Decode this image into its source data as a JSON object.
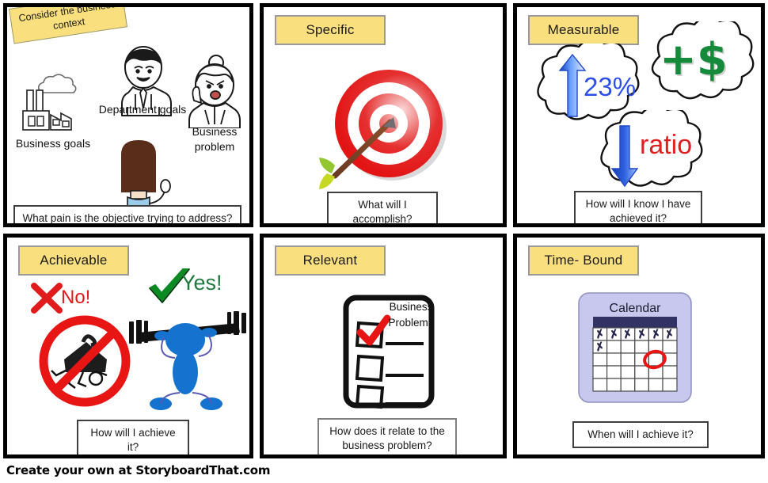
{
  "footer": {
    "text": "Create your own at StoryboardThat.com"
  },
  "panels": [
    {
      "id": "business-context",
      "sticky_note": "Consider the business context",
      "title": null,
      "caption": "What pain is the objective trying to address?",
      "labels": {
        "factory": "Business goals",
        "manager": "Department goals",
        "customer": "Business problem"
      },
      "icons": [
        "factory-icon",
        "smoke-cloud-icon",
        "businessman-figure",
        "angry-woman-figure",
        "woman-raising-hand-figure"
      ]
    },
    {
      "id": "specific",
      "title": "Specific",
      "caption": "What will I accomplish?",
      "icons": [
        "target-dartboard-icon",
        "arrow-icon"
      ]
    },
    {
      "id": "measurable",
      "title": "Measurable",
      "caption": "How will I know I have achieved it?",
      "clouds": [
        {
          "name": "percent-cloud",
          "icon": "up-arrow-icon",
          "text": "23%",
          "color": "#2b4fe8"
        },
        {
          "name": "money-cloud",
          "icon": "dollar-icon",
          "text": "+$",
          "color": "#158A3B"
        },
        {
          "name": "ratio-cloud",
          "icon": "down-arrow-icon",
          "text": "ratio",
          "color": "#E02020"
        }
      ]
    },
    {
      "id": "achievable",
      "title": "Achievable",
      "caption": "How will I achieve it?",
      "marks": [
        {
          "name": "no-mark",
          "symbol": "x-mark-icon",
          "label": "No!",
          "color": "#E01B1B"
        },
        {
          "name": "yes-mark",
          "symbol": "check-mark-icon",
          "label": "Yes!",
          "color": "#1E7A3C"
        }
      ],
      "icons": [
        "prohibition-sign-icon",
        "crushed-stick-figure-icon",
        "weightlifter-figure-icon",
        "barbell-icon"
      ]
    },
    {
      "id": "relevant",
      "title": "Relevant",
      "caption": "How does it relate to the business problem?",
      "checklist": {
        "heading_line1": "Business",
        "heading_line2": "Problems",
        "items": [
          {
            "checked": true
          },
          {
            "checked": false
          },
          {
            "checked": false
          }
        ]
      },
      "icons": [
        "clipboard-icon",
        "red-check-icon"
      ]
    },
    {
      "id": "time-bound",
      "title": "Time- Bound",
      "caption": "When will I achieve it?",
      "calendar": {
        "heading": "Calendar",
        "columns": 6,
        "rows": 5,
        "crossed_days": 7,
        "circled_day": {
          "row": 3,
          "col": 5
        },
        "box_color": "#C8C8EE",
        "header_color": "#323264",
        "circle_color": "#E81515"
      },
      "icons": [
        "calendar-icon",
        "x-day-icon",
        "red-circle-annotation-icon"
      ]
    }
  ]
}
